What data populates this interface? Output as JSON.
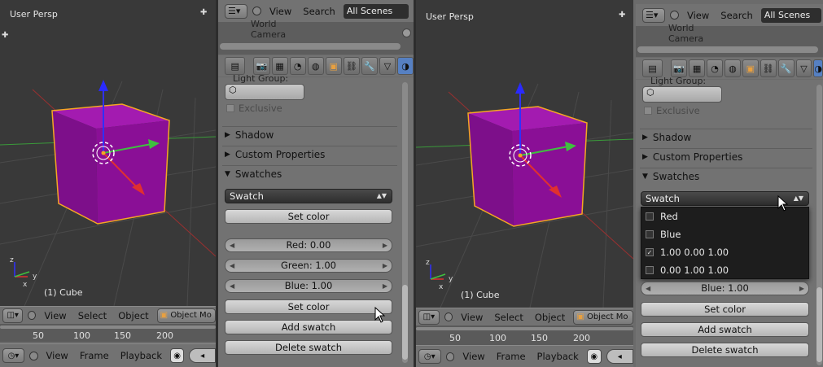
{
  "left": {
    "viewport": {
      "title": "User Persp",
      "object_label": "(1) Cube"
    },
    "header": {
      "menus": [
        "View",
        "Select",
        "Object"
      ],
      "mode": "Object Mo"
    },
    "ruler": [
      "50",
      "100",
      "150",
      "200"
    ],
    "timeline": {
      "menus": [
        "View",
        "Frame",
        "Playback"
      ]
    },
    "outliner": {
      "menus": [
        "View",
        "Search"
      ],
      "scene": "All Scenes",
      "items": [
        "World",
        "Camera"
      ]
    },
    "props": {
      "clipped_label": "Light Group:",
      "exclusive": "Exclusive",
      "panels": {
        "shadow": "Shadow",
        "custom": "Custom Properties",
        "swatches": "Swatches"
      },
      "swatch_select": "Swatch",
      "set_color_top": "Set color",
      "red": "Red: 0.00",
      "green": "Green: 1.00",
      "blue": "Blue: 1.00",
      "set_color": "Set color",
      "add_swatch": "Add swatch",
      "delete_swatch": "Delete swatch"
    }
  },
  "right": {
    "viewport": {
      "title": "User Persp",
      "object_label": "(1) Cube"
    },
    "header": {
      "menus": [
        "View",
        "Select",
        "Object"
      ],
      "mode": "Object Mo"
    },
    "ruler": [
      "50",
      "100",
      "150",
      "200"
    ],
    "timeline": {
      "menus": [
        "View",
        "Frame",
        "Playback"
      ]
    },
    "outliner": {
      "menus": [
        "View",
        "Search"
      ],
      "scene": "All Scenes",
      "items": [
        "World",
        "Camera"
      ]
    },
    "props": {
      "clipped_label": "Light Group:",
      "exclusive": "Exclusive",
      "panels": {
        "shadow": "Shadow",
        "custom": "Custom Properties",
        "swatches": "Swatches"
      },
      "swatch_select": "Swatch",
      "dropdown": [
        {
          "label": "Red",
          "checked": false
        },
        {
          "label": "Blue",
          "checked": false
        },
        {
          "label": "1.00 0.00 1.00",
          "checked": true
        },
        {
          "label": "0.00 1.00 1.00",
          "checked": false
        }
      ],
      "blue": "Blue: 1.00",
      "set_color": "Set color",
      "add_swatch": "Add swatch",
      "delete_swatch": "Delete swatch"
    }
  },
  "colors": {
    "cube": "#8a0f96",
    "cube_top": "#a31bb0",
    "selection": "#f5a623",
    "grid_red": "#b03030",
    "grid_green": "#3a9a3a"
  }
}
